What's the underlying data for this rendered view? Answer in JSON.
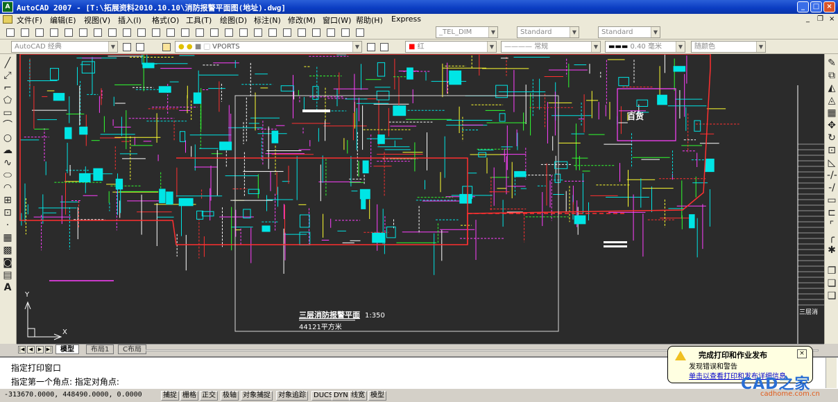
{
  "window": {
    "app_icon": "AutoCAD-logo",
    "title": "AutoCAD 2007 - [T:\\拓展资料2010.10.10\\消防报警平面图(地址).dwg]",
    "minimize": "_",
    "maximize": "□",
    "close": "×"
  },
  "menu": {
    "items": [
      "文件(F)",
      "编辑(E)",
      "视图(V)",
      "插入(I)",
      "格式(O)",
      "工具(T)",
      "绘图(D)",
      "标注(N)",
      "修改(M)",
      "窗口(W)",
      "帮助(H)",
      "Express"
    ],
    "doc_min": "_",
    "doc_restore": "❐",
    "doc_close": "×"
  },
  "toolbar1": {
    "text_style": "_TEL_DIM",
    "dim_style": "Standard",
    "table_style": "Standard"
  },
  "toolbar2": {
    "workspace": "AutoCAD 经典",
    "layer": "VPORTS",
    "color": "红",
    "linetype": "常规",
    "lineweight": "0.40 毫米",
    "plotstyle": "随颜色"
  },
  "drawing": {
    "area_label": "百货",
    "title_label": "三层消防报警平面",
    "scale_label": "1:350",
    "area_value": "44121平方米",
    "right_edge_label": "三层消",
    "ucs_x": "X",
    "ucs_y": "Y"
  },
  "tabs": {
    "model": "模型",
    "layout1": "布局1",
    "layout2": "C布局"
  },
  "command": {
    "line1": "指定打印窗口",
    "line2": "指定第一个角点: 指定对角点:"
  },
  "status": {
    "coords": "-313670.0000, 448490.0000, 0.0000",
    "buttons": [
      "捕捉",
      "栅格",
      "正交",
      "极轴",
      "对象捕捉",
      "对象追踪",
      "DUCS",
      "DYN",
      "线宽",
      "模型"
    ]
  },
  "balloon": {
    "icon": "warning-icon",
    "title": "完成打印和作业发布",
    "line1": "发现错误和警告",
    "link": "单击以查看打印和发布详细信息"
  },
  "watermark": {
    "text": "CAD之家",
    "url": "cadhome.com.cn"
  },
  "colors": {
    "title_bar": "#0a3cc2",
    "canvas_bg": "#2b2b2b",
    "cad_red": "#ff3030",
    "cad_cyan": "#00e5e5",
    "cad_magenta": "#ff40ff",
    "cad_yellow": "#ffff30",
    "cad_green": "#30ff30"
  }
}
